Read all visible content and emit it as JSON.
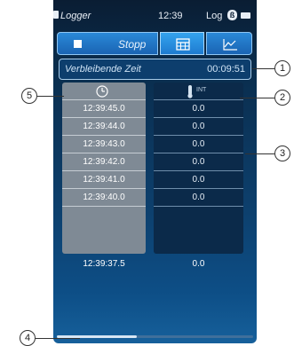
{
  "status_bar": {
    "app_name": "Logger",
    "time": "12:39",
    "log_label": "Log",
    "bluetooth_symbol": "ß"
  },
  "toolbar": {
    "stop_label": "Stopp",
    "icons": [
      "stop-icon",
      "calculator-icon",
      "chart-icon"
    ]
  },
  "remaining": {
    "label": "Verbleibende Zeit",
    "value": "00:09:51"
  },
  "table": {
    "time_column_icon": "clock-icon",
    "int_column_icon": "probe-icon",
    "int_column_label": "INT",
    "rows": [
      {
        "time": "12:39:45.0",
        "value": "0.0"
      },
      {
        "time": "12:39:44.0",
        "value": "0.0"
      },
      {
        "time": "12:39:43.0",
        "value": "0.0"
      },
      {
        "time": "12:39:42.0",
        "value": "0.0"
      },
      {
        "time": "12:39:41.0",
        "value": "0.0"
      },
      {
        "time": "12:39:40.0",
        "value": "0.0"
      }
    ],
    "last_row": {
      "time": "12:39:37.5",
      "value": "0.0"
    }
  },
  "callouts": {
    "c1": "1",
    "c2": "2",
    "c3": "3",
    "c4": "4",
    "c5": "5"
  },
  "colors": {
    "accent": "#2a89d8",
    "time_column": "#7f8a95",
    "int_column": "#0b2a4a"
  }
}
